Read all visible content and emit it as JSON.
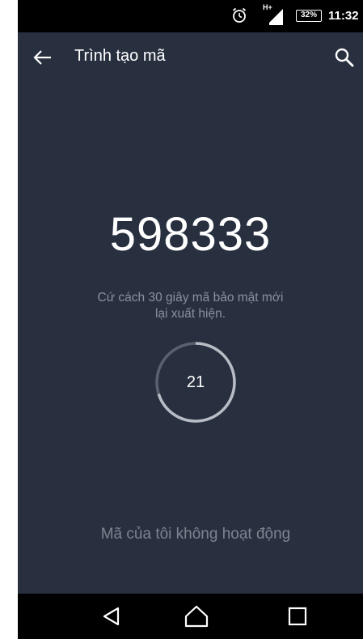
{
  "status_bar": {
    "network": "H+",
    "battery": "32%",
    "time": "11:32"
  },
  "app_bar": {
    "title": "Trình tạo mã"
  },
  "main": {
    "code": "598333",
    "description_line1": "Cứ cách 30 giây mã bảo mật mới",
    "description_line2": "lại xuất hiện.",
    "countdown": "21",
    "countdown_progress": 0.7,
    "not_working_link": "Mã của tôi không hoạt động"
  },
  "colors": {
    "background": "#283040",
    "ring_track": "#5a6070",
    "ring_progress": "#b8bcc4"
  }
}
